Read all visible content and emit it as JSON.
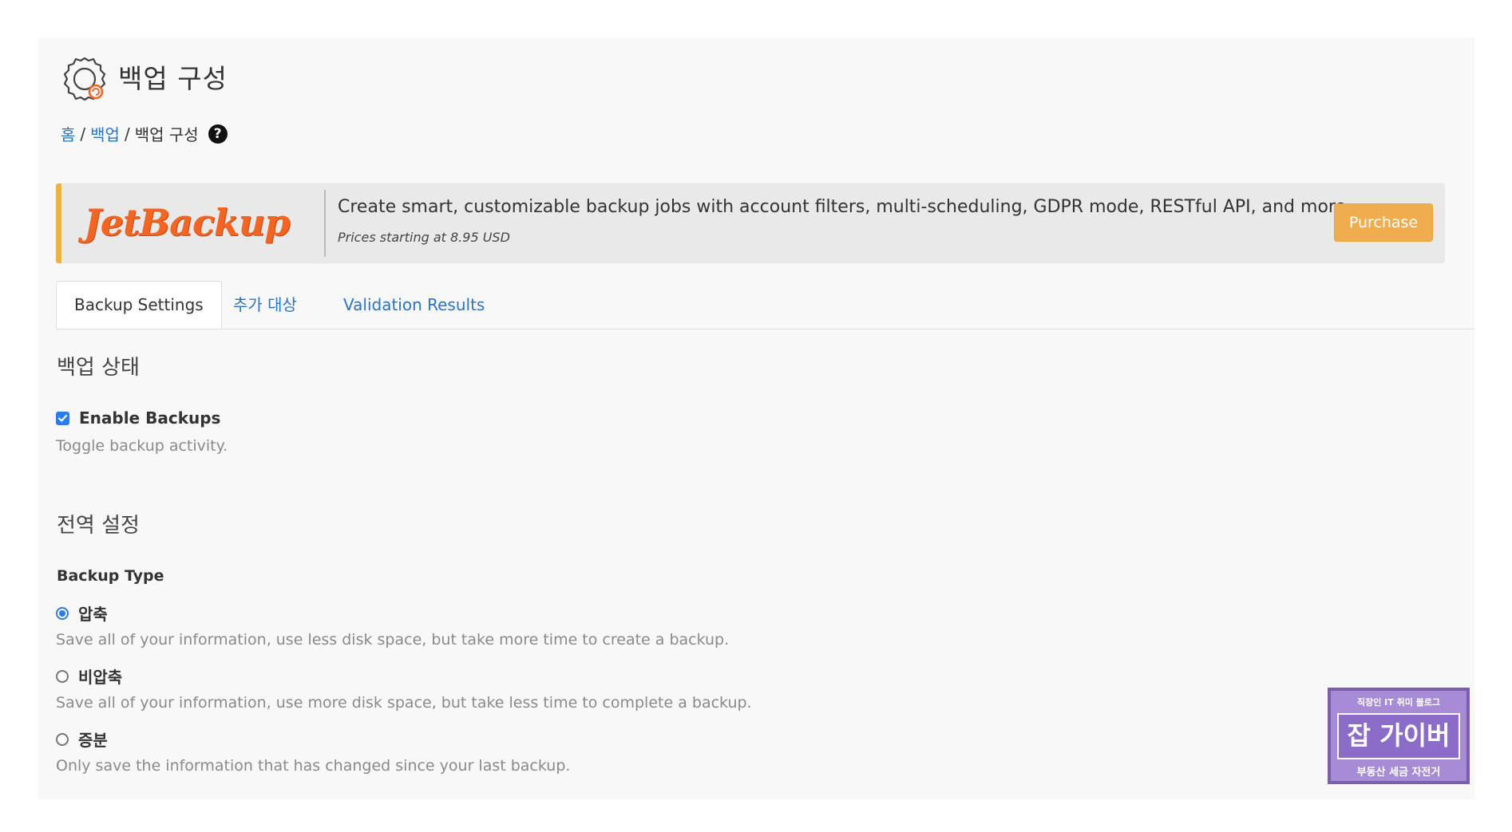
{
  "header": {
    "title": "백업 구성",
    "icon": "backup-gear-icon"
  },
  "breadcrumb": {
    "home": "홈",
    "backup": "백업",
    "current": "백업 구성",
    "separator": "/",
    "help_glyph": "?"
  },
  "banner": {
    "logo_text": "JetBackup",
    "headline": "Create smart, customizable backup jobs with account filters, multi-scheduling, GDPR mode, RESTful API, and more.",
    "subtext": "Prices starting at 8.95 USD",
    "button_label": "Purchase",
    "accent_color": "#f0ad4e"
  },
  "tabs": [
    {
      "label": "Backup Settings",
      "active": true
    },
    {
      "label": "추가 대상",
      "active": false
    },
    {
      "label": "Validation Results",
      "active": false
    }
  ],
  "backup_status": {
    "title": "백업 상태",
    "enable_label": "Enable Backups",
    "enable_checked": true,
    "enable_help": "Toggle backup activity."
  },
  "global_settings": {
    "title": "전역 설정",
    "backup_type_label": "Backup Type",
    "options": [
      {
        "label": "압축",
        "selected": true,
        "help": "Save all of your information, use less disk space, but take more time to create a backup."
      },
      {
        "label": "비압축",
        "selected": false,
        "help": "Save all of your information, use more disk space, but take less time to complete a backup."
      },
      {
        "label": "증분",
        "selected": false,
        "help": "Only save the information that has changed since your last backup."
      }
    ]
  },
  "watermark": {
    "top": "직장인 IT 취미 블로그",
    "main": "잡 가이버",
    "bottom": "부동산 세금 자전거"
  }
}
